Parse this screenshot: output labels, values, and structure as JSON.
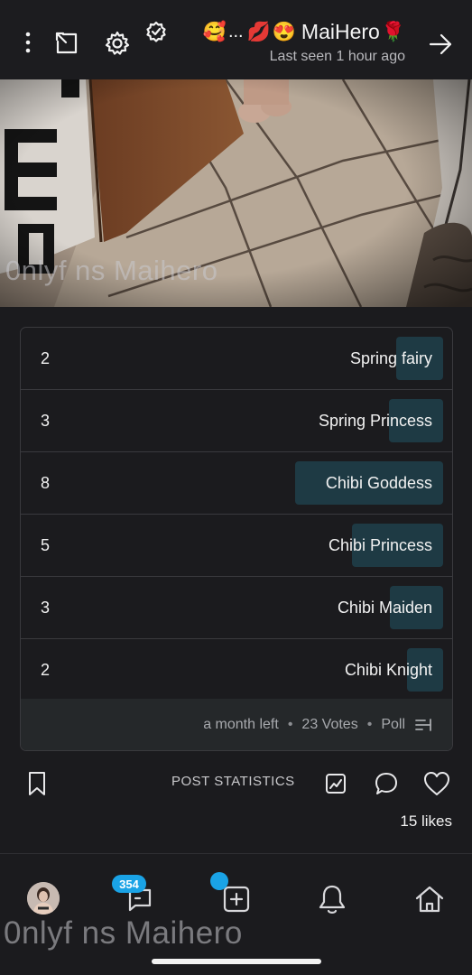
{
  "header": {
    "name": "MaiHero",
    "emojis": [
      "🌹",
      "😍",
      "💋",
      "🥰"
    ],
    "ellipsis": "...",
    "last_seen": "Last seen 1 hour ago"
  },
  "photo": {
    "watermark": "0nlyf ns Maihero"
  },
  "poll": {
    "options": [
      {
        "label": "Spring fairy",
        "votes": "2"
      },
      {
        "label": "Spring Princess",
        "votes": "3"
      },
      {
        "label": "Chibi Goddess",
        "votes": "8"
      },
      {
        "label": "Chibi Princess",
        "votes": "5"
      },
      {
        "label": "Chibi Maiden",
        "votes": "3"
      },
      {
        "label": "Chibi Knight",
        "votes": "2"
      }
    ],
    "footer": {
      "type": "Poll",
      "votes": "23 Votes",
      "time_left": "a month left"
    }
  },
  "actions": {
    "post_statistics": "POST STATISTICS",
    "likes": "15 likes"
  },
  "bottom_nav": {
    "messages_badge": "354",
    "watermark": "0nlyf ns Maihero"
  },
  "colors": {
    "background": "#1b1b1e",
    "poll_fill": "#1e3a44",
    "accent": "#1aa3e6"
  }
}
